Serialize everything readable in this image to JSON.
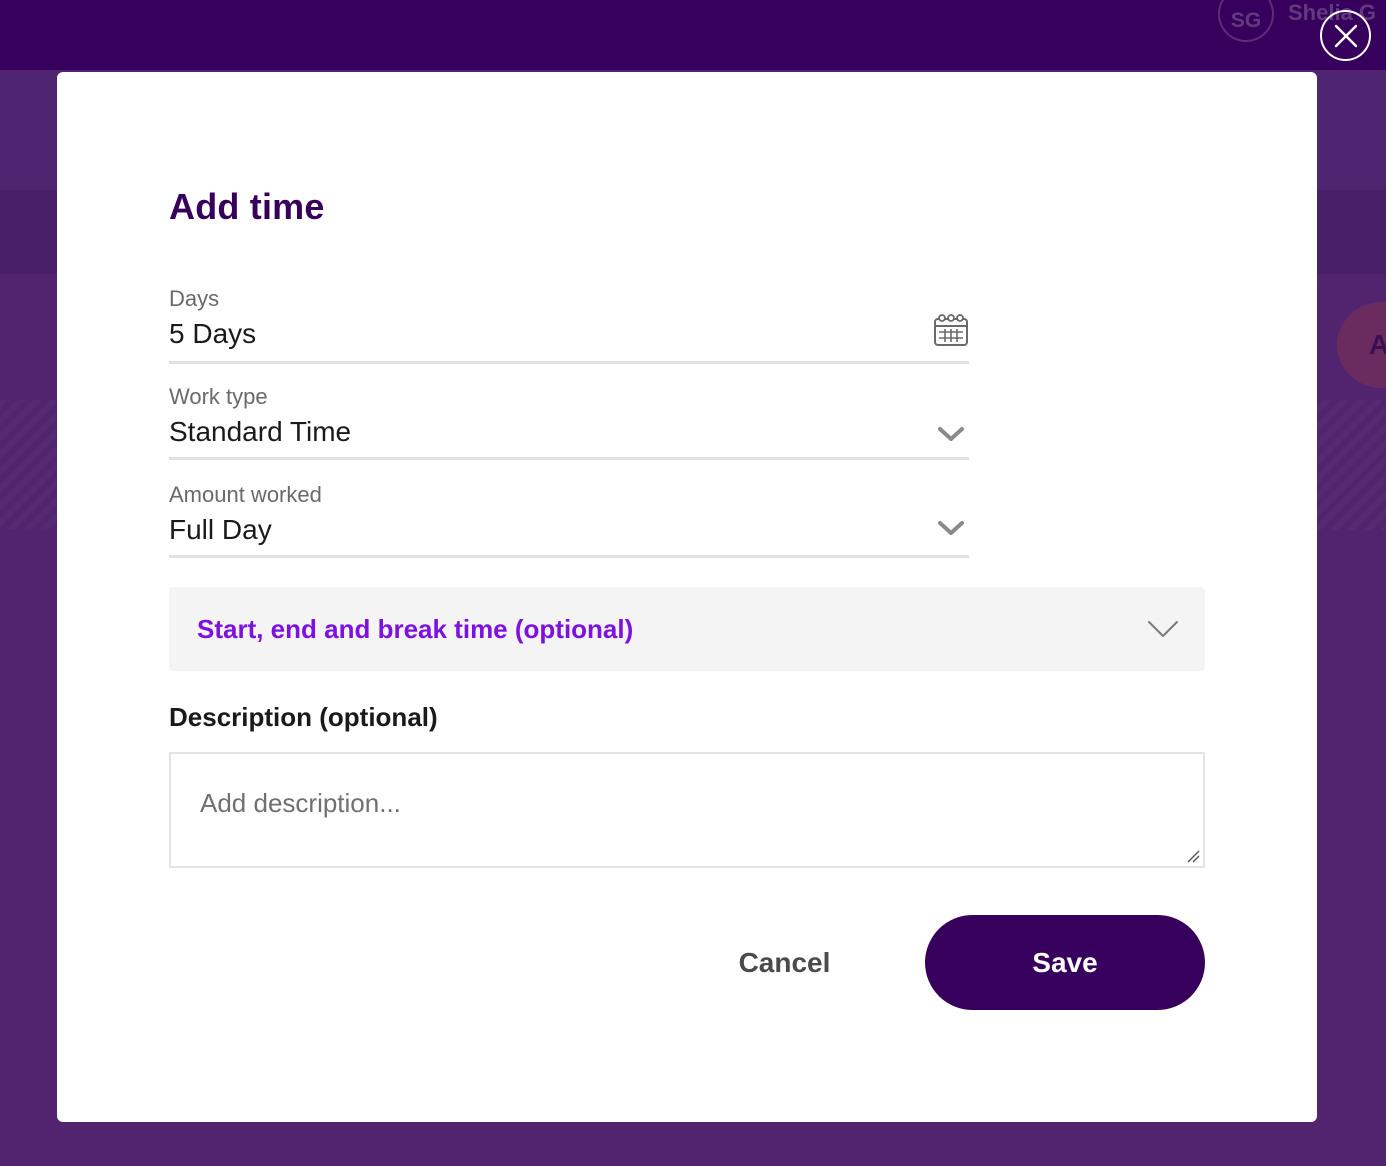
{
  "background": {
    "avatar_initials": "SG",
    "username": "Shelia G",
    "side_circle_letter": "A"
  },
  "modal": {
    "title": "Add time",
    "close_icon": "close-icon",
    "fields": {
      "days": {
        "label": "Days",
        "value": "5 Days",
        "icon": "calendar-icon"
      },
      "work_type": {
        "label": "Work type",
        "value": "Standard Time",
        "icon": "chevron-down-icon"
      },
      "amount_worked": {
        "label": "Amount worked",
        "value": "Full Day",
        "icon": "chevron-down-icon"
      }
    },
    "accordion": {
      "label": "Start, end and break time (optional)",
      "icon": "chevron-down-icon",
      "expanded": false
    },
    "description": {
      "label": "Description (optional)",
      "value": "",
      "placeholder": "Add description..."
    },
    "buttons": {
      "cancel": "Cancel",
      "save": "Save"
    }
  },
  "colors": {
    "brand_dark": "#36005c",
    "accent_purple": "#7d12e0",
    "overlay": "#522470"
  }
}
